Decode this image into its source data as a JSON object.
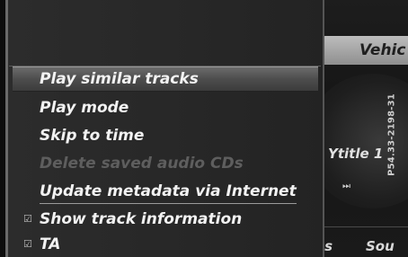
{
  "background_player": {
    "header_title": "Vehic",
    "track_title": "Ytitle  1",
    "forward_symbol": "⏭",
    "bottom_left": "es",
    "bottom_right": "Sou"
  },
  "menu": {
    "items": [
      {
        "label": "Play similar tracks",
        "state": "selected",
        "check": ""
      },
      {
        "label": "Play mode",
        "state": "normal",
        "check": ""
      },
      {
        "label": "Skip to time",
        "state": "normal",
        "check": ""
      },
      {
        "label": "Delete saved audio CDs",
        "state": "disabled",
        "check": ""
      },
      {
        "label": "Update metadata via Internet",
        "state": "normal",
        "check": ""
      },
      {
        "label": "Show track information",
        "state": "normal",
        "check": "☑"
      },
      {
        "label": "TA",
        "state": "normal",
        "check": "☑"
      }
    ]
  },
  "watermark": "P54.33-2198-31"
}
